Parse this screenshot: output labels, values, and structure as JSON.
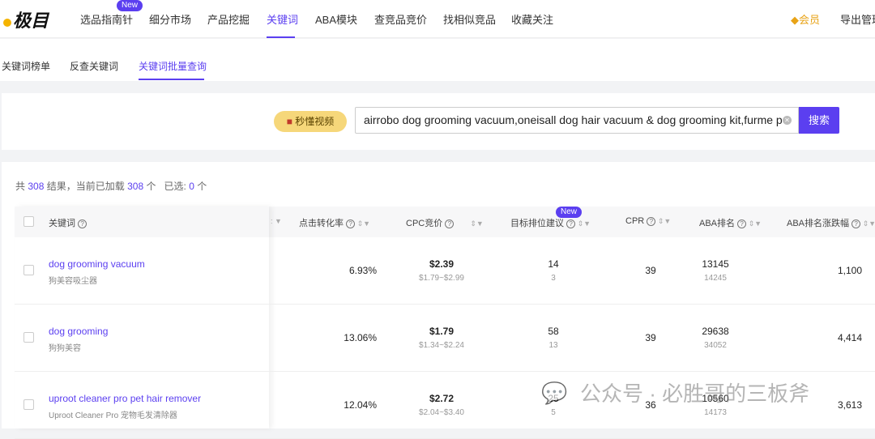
{
  "brand": {
    "logo_text": "极目"
  },
  "topnav": {
    "items": [
      "选品指南针",
      "细分市场",
      "产品挖掘",
      "关键词",
      "ABA模块",
      "查竞品竞价",
      "找相似竞品",
      "收藏关注"
    ],
    "active": "关键词",
    "new_badge": "New",
    "member": "会员",
    "export": "导出管理"
  },
  "subnav": {
    "items": [
      "关键词榜单",
      "反查关键词",
      "关键词批量查询"
    ],
    "active": "关键词批量查询"
  },
  "search": {
    "video_button": "秒懂视频",
    "value": "airrobo dog grooming vacuum,oneisall dog hair vacuum & dog grooming kit,furme p",
    "button": "搜索"
  },
  "summary": {
    "p1": "共",
    "total": "308",
    "p2": "结果，当前已加载",
    "loaded": "308",
    "p3": "个",
    "p4": "已选:",
    "selected": "0",
    "p5": "个"
  },
  "table": {
    "headers": {
      "keyword": "关键词",
      "cvr": "点击转化率",
      "cpc": "CPC竞价",
      "target": "目标排位建议",
      "target_badge": "New",
      "cpr": "CPR",
      "aba": "ABA排名",
      "aba_change": "ABA排名涨跌幅"
    },
    "rows": [
      {
        "keyword": "dog grooming vacuum",
        "translation": "狗美容吸尘器",
        "cvr": "6.93%",
        "cpc": "$2.39",
        "cpc_range": "$1.79~$2.99",
        "target": "14",
        "target_sub": "3",
        "cpr": "39",
        "aba": "13145",
        "aba_prev": "14245",
        "aba_change": "1,100"
      },
      {
        "keyword": "dog grooming",
        "translation": "狗狗美容",
        "cvr": "13.06%",
        "cpc": "$1.79",
        "cpc_range": "$1.34~$2.24",
        "target": "58",
        "target_sub": "13",
        "cpr": "39",
        "aba": "29638",
        "aba_prev": "34052",
        "aba_change": "4,414"
      },
      {
        "keyword": "uproot cleaner pro pet hair remover",
        "translation": "Uproot Cleaner Pro 宠物毛发清除器",
        "cvr": "12.04%",
        "cpc": "$2.72",
        "cpc_range": "$2.04~$3.40",
        "target": "25",
        "target_sub": "5",
        "cpr": "36",
        "aba": "10560",
        "aba_prev": "14173",
        "aba_change": "3,613"
      }
    ]
  },
  "watermark": "公众号 · 必胜哥的三板斧",
  "colors": {
    "accent": "#5b3ff0",
    "video_button": "#f6d77a"
  }
}
